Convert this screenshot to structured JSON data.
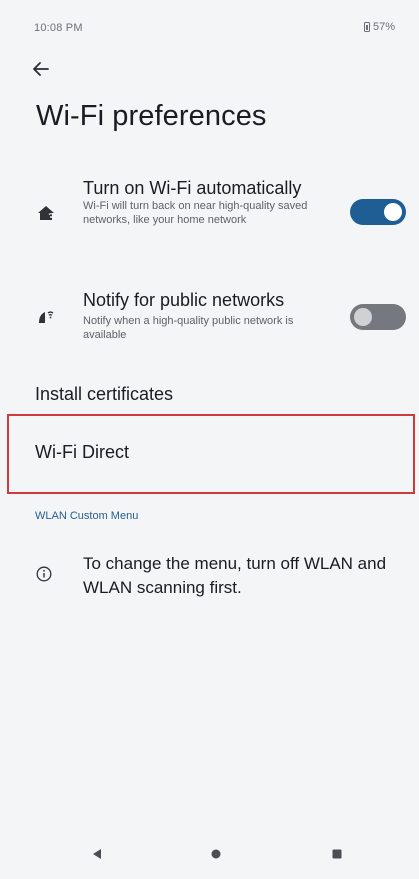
{
  "status_bar": {
    "time": "10:08 PM",
    "battery": "57%"
  },
  "header": {
    "back_icon": "arrow-back-icon",
    "title": "Wi-Fi preferences"
  },
  "preferences": [
    {
      "icon": "wifi-home-icon",
      "title": "Turn on Wi-Fi automatically",
      "summary": "Wi-Fi will turn back on near high-quality saved networks, like your home network",
      "toggle_state": "on"
    },
    {
      "icon": "wifi-notification-icon",
      "title": "Notify for public networks",
      "summary": "Notify when a high-quality public network is available",
      "toggle_state": "off"
    }
  ],
  "items": {
    "install_certificates": "Install certificates",
    "wifi_direct": "Wi-Fi Direct"
  },
  "wlan_section": {
    "header": "WLAN Custom Menu",
    "info_icon": "info-icon",
    "info_text": "To change the menu, turn off WLAN and WLAN scanning first."
  },
  "nav_bar": {
    "back_icon": "nav-back-icon",
    "home_icon": "nav-home-icon",
    "recents_icon": "nav-recents-icon"
  },
  "colors": {
    "accent": "#1f5e95",
    "section_header": "#2a5d8f",
    "highlight": "#d03a3e",
    "background": "#f4f5f7"
  }
}
